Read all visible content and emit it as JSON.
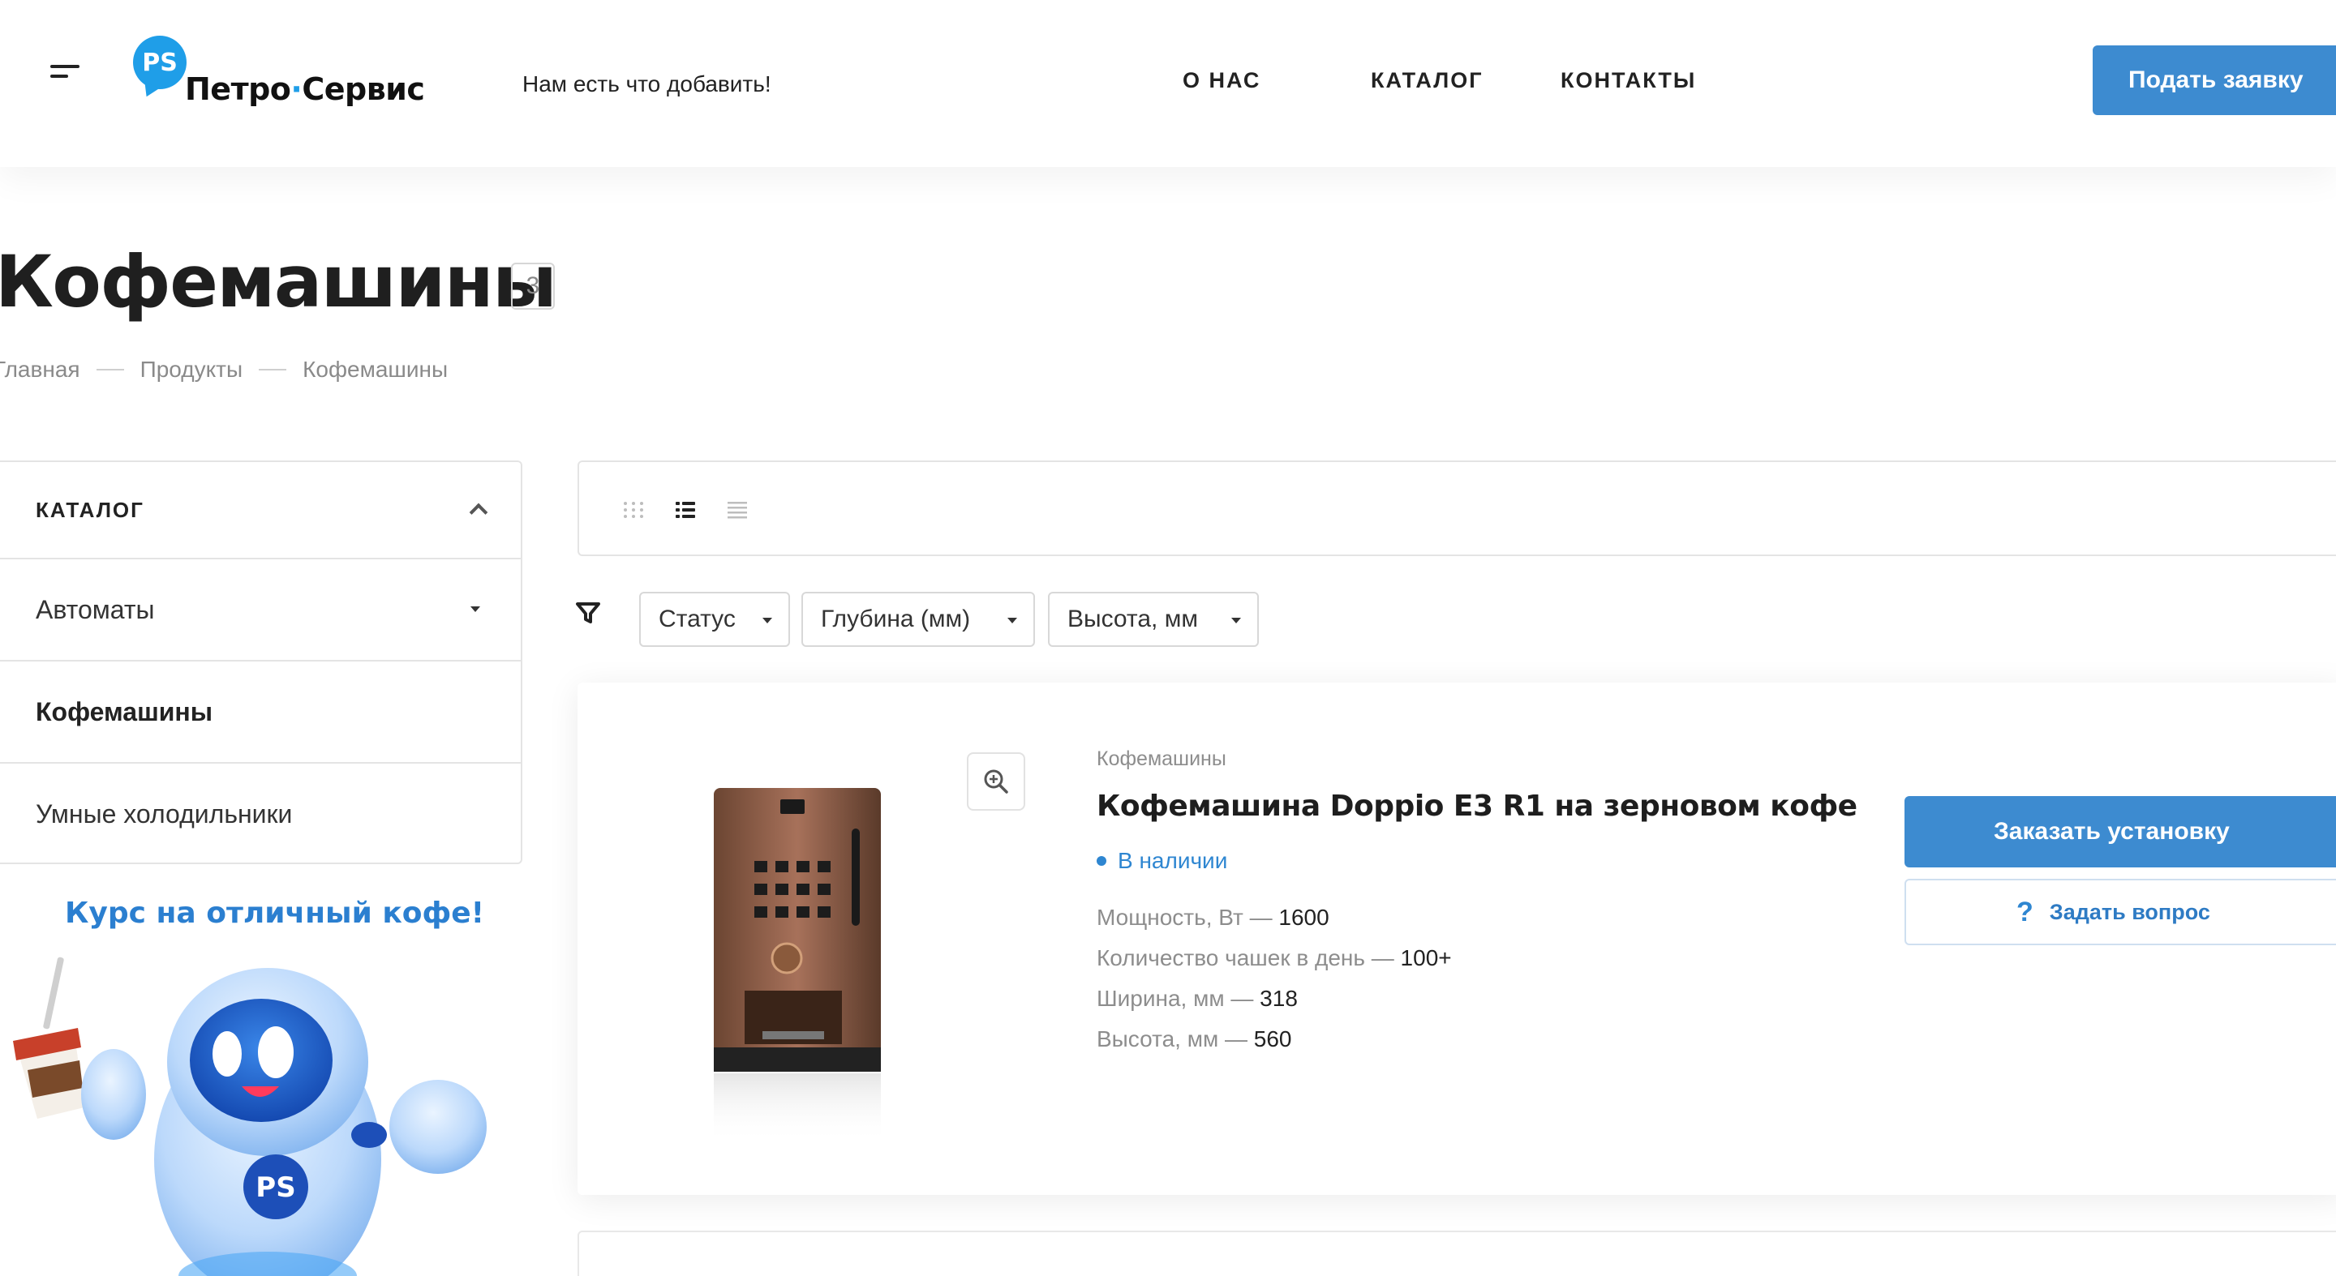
{
  "header": {
    "logo_ps": "PS",
    "logo_word1": "Петро",
    "logo_dot": "·",
    "logo_word2": "Сервис",
    "tagline": "Нам есть что добавить!",
    "nav": {
      "about": "О НАС",
      "catalog": "КАТАЛОГ",
      "contacts": "КОНТАКТЫ"
    },
    "apply_button": "Подать заявку"
  },
  "page": {
    "title": "Кофемашины",
    "count": "3",
    "breadcrumb": [
      "Главная",
      "Продукты",
      "Кофемашины"
    ]
  },
  "sidebar": {
    "heading": "КАТАЛОГ",
    "items": [
      {
        "label": "Автоматы"
      },
      {
        "label": "Кофемашины"
      },
      {
        "label": "Умные холодильники"
      }
    ]
  },
  "promo": {
    "title": "Курс на отличный кофе!",
    "badge": "PS"
  },
  "filters": {
    "status": "Статус",
    "depth": "Глубина (мм)",
    "height": "Высота, мм"
  },
  "product": {
    "category": "Кофемашины",
    "name": "Кофемашина Doppio E3 R1 на зерновом кофе",
    "stock": "В наличии",
    "specs": [
      {
        "label": "Мощность, Вт — ",
        "value": "1600"
      },
      {
        "label": "Количество чашек в день — ",
        "value": "100+"
      },
      {
        "label": "Ширина, мм — ",
        "value": "318"
      },
      {
        "label": "Высота, мм — ",
        "value": "560"
      }
    ],
    "order_button": "Заказать установку",
    "ask_button": "Задать вопрос",
    "ask_icon": "?"
  },
  "colors": {
    "accent": "#3d8bd0",
    "brand": "#1f9ee8",
    "stock": "#2e86d1"
  },
  "icons": {
    "menu": "hamburger-menu-icon",
    "zoom": "zoom-in-icon",
    "filter": "filter-funnel-icon",
    "view_grid": "grid-view-icon",
    "view_list": "list-view-icon",
    "view_table": "table-view-icon"
  }
}
